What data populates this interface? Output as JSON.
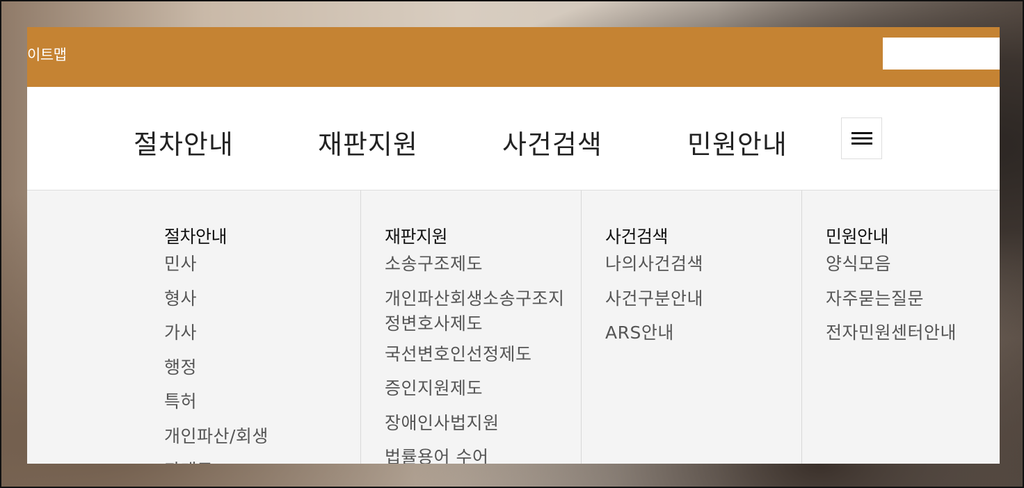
{
  "topbar": {
    "title": "이트맵",
    "search_placeholder": ""
  },
  "nav": {
    "items": [
      "절차안내",
      "재판지원",
      "사건검색",
      "민원안내"
    ],
    "menu_icon": "hamburger-icon"
  },
  "dropdown": {
    "columns": [
      {
        "title": "절차안내",
        "items": [
          "민사",
          "형사",
          "가사",
          "행정",
          "특허",
          "개인파산/회생",
          "과태료"
        ]
      },
      {
        "title": "재판지원",
        "items": [
          "소송구조제도",
          "개인파산회생소송구조지정변호사제도",
          "국선변호인선정제도",
          "증인지원제도",
          "장애인사법지원",
          "법률용어 수어"
        ]
      },
      {
        "title": "사건검색",
        "items": [
          "나의사건검색",
          "사건구분안내",
          "ARS안내"
        ]
      },
      {
        "title": "민원안내",
        "items": [
          "양식모음",
          "자주묻는질문",
          "전자민원센터안내"
        ]
      }
    ]
  },
  "colors": {
    "topbar": "#c58333",
    "dropdown_bg": "#f4f4f4"
  }
}
